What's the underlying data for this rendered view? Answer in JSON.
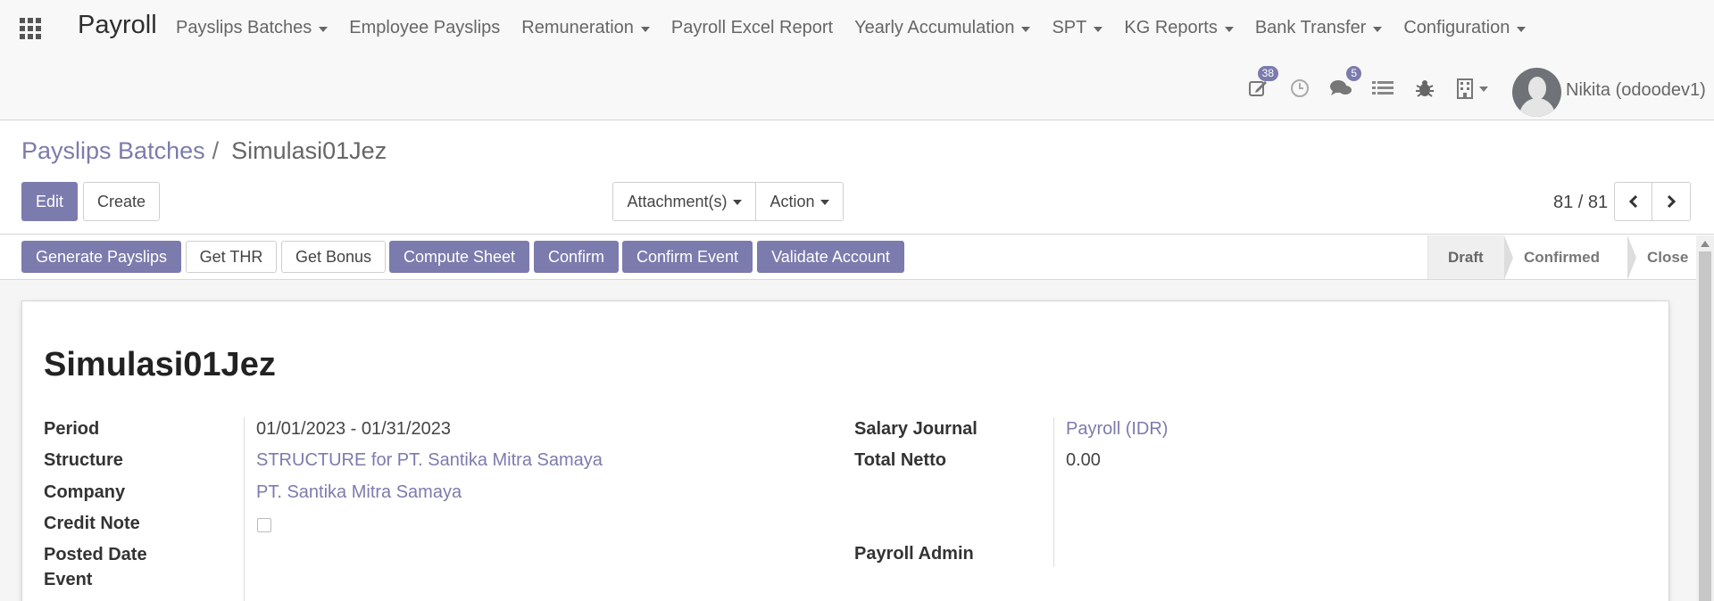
{
  "app": {
    "title": "Payroll"
  },
  "menu": [
    {
      "label": "Payslips Batches",
      "dropdown": true
    },
    {
      "label": "Employee Payslips",
      "dropdown": false
    },
    {
      "label": "Remuneration",
      "dropdown": true
    },
    {
      "label": "Payroll Excel Report",
      "dropdown": false
    },
    {
      "label": "Yearly Accumulation",
      "dropdown": true
    },
    {
      "label": "SPT",
      "dropdown": true
    },
    {
      "label": "KG Reports",
      "dropdown": true
    },
    {
      "label": "Bank Transfer",
      "dropdown": true
    },
    {
      "label": "Configuration",
      "dropdown": true
    }
  ],
  "systray": {
    "activities_count": "38",
    "messages_count": "5",
    "user_name": "Nikita (odoodev1)"
  },
  "breadcrumb": {
    "parent": "Payslips Batches",
    "separator": "/",
    "current": "Simulasi01Jez"
  },
  "control": {
    "edit_label": "Edit",
    "create_label": "Create",
    "attachments_label": "Attachment(s)",
    "action_label": "Action",
    "pager": "81 / 81"
  },
  "statusbar": {
    "buttons": [
      "Generate Payslips",
      "Get THR",
      "Get Bonus",
      "Compute Sheet",
      "Confirm",
      "Confirm Event",
      "Validate Account"
    ],
    "stages": [
      "Draft",
      "Confirmed",
      "Close"
    ],
    "active_stage": "Draft"
  },
  "form": {
    "title": "Simulasi01Jez",
    "labels": {
      "period": "Period",
      "structure": "Structure",
      "company": "Company",
      "credit_note": "Credit Note",
      "posted_date_event": "Posted Date Event",
      "salary_journal": "Salary Journal",
      "total_netto": "Total Netto",
      "payroll_admin": "Payroll Admin"
    },
    "values": {
      "period": "01/01/2023 - 01/31/2023",
      "structure": "STRUCTURE for PT. Santika Mitra Samaya",
      "company": "PT. Santika Mitra Samaya",
      "credit_note_checked": false,
      "salary_journal": "Payroll (IDR)",
      "total_netto": "0.00"
    }
  },
  "colors": {
    "accent": "#7c7bad"
  }
}
